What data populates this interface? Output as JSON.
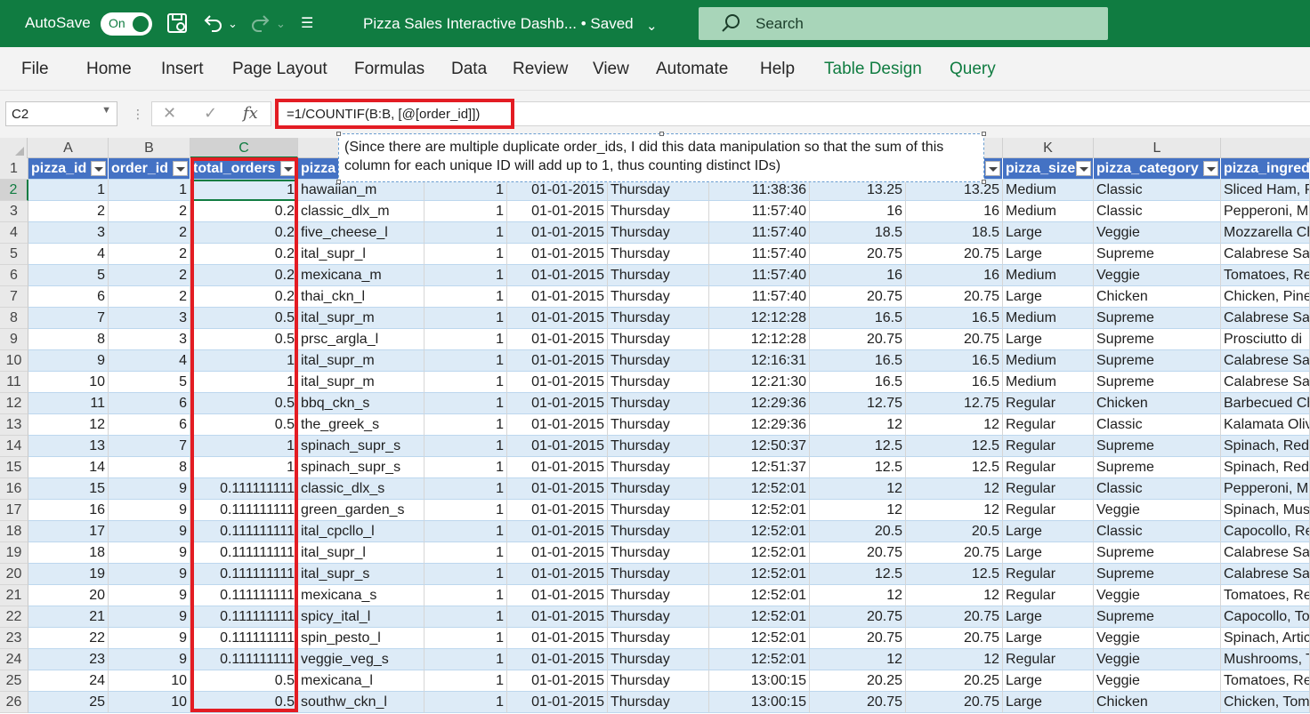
{
  "titlebar": {
    "autosave_label": "AutoSave",
    "autosave_state": "On",
    "doc_title": "Pizza Sales Interactive Dashb...  •  Saved",
    "search_placeholder": "Search"
  },
  "ribbon": {
    "tabs": [
      "File",
      "Home",
      "Insert",
      "Page Layout",
      "Formulas",
      "Data",
      "Review",
      "View",
      "Automate",
      "Help",
      "Table Design",
      "Query"
    ]
  },
  "formula_bar": {
    "name_box": "C2",
    "formula": "=1/COUNTIF(B:B, [@[order_id]])"
  },
  "comment": {
    "text": "(Since there are multiple duplicate order_ids, I did this data manipulation so that the sum of this column for each unique ID will add up to 1, thus counting distinct IDs)"
  },
  "grid": {
    "column_letters": [
      "A",
      "B",
      "C",
      "K",
      "L"
    ],
    "headers": [
      "pizza_id",
      "order_id",
      "total_orders",
      "pizza",
      "",
      "",
      "",
      "",
      "",
      "",
      "pizza_size",
      "pizza_category",
      "pizza_ingredi"
    ],
    "rows": [
      [
        "1",
        "1",
        "1",
        "hawaiian_m",
        "1",
        "01-01-2015",
        "Thursday",
        "11:38:36",
        "13.25",
        "13.25",
        "Medium",
        "Classic",
        "Sliced Ham, P"
      ],
      [
        "2",
        "2",
        "0.2",
        "classic_dlx_m",
        "1",
        "01-01-2015",
        "Thursday",
        "11:57:40",
        "16",
        "16",
        "Medium",
        "Classic",
        "Pepperoni, M"
      ],
      [
        "3",
        "2",
        "0.2",
        "five_cheese_l",
        "1",
        "01-01-2015",
        "Thursday",
        "11:57:40",
        "18.5",
        "18.5",
        "Large",
        "Veggie",
        "Mozzarella Ch"
      ],
      [
        "4",
        "2",
        "0.2",
        "ital_supr_l",
        "1",
        "01-01-2015",
        "Thursday",
        "11:57:40",
        "20.75",
        "20.75",
        "Large",
        "Supreme",
        "Calabrese Sal"
      ],
      [
        "5",
        "2",
        "0.2",
        "mexicana_m",
        "1",
        "01-01-2015",
        "Thursday",
        "11:57:40",
        "16",
        "16",
        "Medium",
        "Veggie",
        "Tomatoes, Re"
      ],
      [
        "6",
        "2",
        "0.2",
        "thai_ckn_l",
        "1",
        "01-01-2015",
        "Thursday",
        "11:57:40",
        "20.75",
        "20.75",
        "Large",
        "Chicken",
        "Chicken, Pine"
      ],
      [
        "7",
        "3",
        "0.5",
        "ital_supr_m",
        "1",
        "01-01-2015",
        "Thursday",
        "12:12:28",
        "16.5",
        "16.5",
        "Medium",
        "Supreme",
        "Calabrese Sal"
      ],
      [
        "8",
        "3",
        "0.5",
        "prsc_argla_l",
        "1",
        "01-01-2015",
        "Thursday",
        "12:12:28",
        "20.75",
        "20.75",
        "Large",
        "Supreme",
        "Prosciutto di"
      ],
      [
        "9",
        "4",
        "1",
        "ital_supr_m",
        "1",
        "01-01-2015",
        "Thursday",
        "12:16:31",
        "16.5",
        "16.5",
        "Medium",
        "Supreme",
        "Calabrese Sal"
      ],
      [
        "10",
        "5",
        "1",
        "ital_supr_m",
        "1",
        "01-01-2015",
        "Thursday",
        "12:21:30",
        "16.5",
        "16.5",
        "Medium",
        "Supreme",
        "Calabrese Sal"
      ],
      [
        "11",
        "6",
        "0.5",
        "bbq_ckn_s",
        "1",
        "01-01-2015",
        "Thursday",
        "12:29:36",
        "12.75",
        "12.75",
        "Regular",
        "Chicken",
        "Barbecued Ch"
      ],
      [
        "12",
        "6",
        "0.5",
        "the_greek_s",
        "1",
        "01-01-2015",
        "Thursday",
        "12:29:36",
        "12",
        "12",
        "Regular",
        "Classic",
        "Kalamata Oliv"
      ],
      [
        "13",
        "7",
        "1",
        "spinach_supr_s",
        "1",
        "01-01-2015",
        "Thursday",
        "12:50:37",
        "12.5",
        "12.5",
        "Regular",
        "Supreme",
        "Spinach, Red"
      ],
      [
        "14",
        "8",
        "1",
        "spinach_supr_s",
        "1",
        "01-01-2015",
        "Thursday",
        "12:51:37",
        "12.5",
        "12.5",
        "Regular",
        "Supreme",
        "Spinach, Red"
      ],
      [
        "15",
        "9",
        "0.111111111",
        "classic_dlx_s",
        "1",
        "01-01-2015",
        "Thursday",
        "12:52:01",
        "12",
        "12",
        "Regular",
        "Classic",
        "Pepperoni, M"
      ],
      [
        "16",
        "9",
        "0.111111111",
        "green_garden_s",
        "1",
        "01-01-2015",
        "Thursday",
        "12:52:01",
        "12",
        "12",
        "Regular",
        "Veggie",
        "Spinach, Mus"
      ],
      [
        "17",
        "9",
        "0.111111111",
        "ital_cpcllo_l",
        "1",
        "01-01-2015",
        "Thursday",
        "12:52:01",
        "20.5",
        "20.5",
        "Large",
        "Classic",
        "Capocollo, Re"
      ],
      [
        "18",
        "9",
        "0.111111111",
        "ital_supr_l",
        "1",
        "01-01-2015",
        "Thursday",
        "12:52:01",
        "20.75",
        "20.75",
        "Large",
        "Supreme",
        "Calabrese Sal"
      ],
      [
        "19",
        "9",
        "0.111111111",
        "ital_supr_s",
        "1",
        "01-01-2015",
        "Thursday",
        "12:52:01",
        "12.5",
        "12.5",
        "Regular",
        "Supreme",
        "Calabrese Sal"
      ],
      [
        "20",
        "9",
        "0.111111111",
        "mexicana_s",
        "1",
        "01-01-2015",
        "Thursday",
        "12:52:01",
        "12",
        "12",
        "Regular",
        "Veggie",
        "Tomatoes, Re"
      ],
      [
        "21",
        "9",
        "0.111111111",
        "spicy_ital_l",
        "1",
        "01-01-2015",
        "Thursday",
        "12:52:01",
        "20.75",
        "20.75",
        "Large",
        "Supreme",
        "Capocollo, To"
      ],
      [
        "22",
        "9",
        "0.111111111",
        "spin_pesto_l",
        "1",
        "01-01-2015",
        "Thursday",
        "12:52:01",
        "20.75",
        "20.75",
        "Large",
        "Veggie",
        "Spinach, Artic"
      ],
      [
        "23",
        "9",
        "0.111111111",
        "veggie_veg_s",
        "1",
        "01-01-2015",
        "Thursday",
        "12:52:01",
        "12",
        "12",
        "Regular",
        "Veggie",
        "Mushrooms, T"
      ],
      [
        "24",
        "10",
        "0.5",
        "mexicana_l",
        "1",
        "01-01-2015",
        "Thursday",
        "13:00:15",
        "20.25",
        "20.25",
        "Large",
        "Veggie",
        "Tomatoes, Re"
      ],
      [
        "25",
        "10",
        "0.5",
        "southw_ckn_l",
        "1",
        "01-01-2015",
        "Thursday",
        "13:00:15",
        "20.75",
        "20.75",
        "Large",
        "Chicken",
        "Chicken, Tom"
      ]
    ]
  },
  "colors": {
    "excel_green": "#107c41",
    "header_blue": "#4472c4",
    "band_blue": "#ddebf7",
    "highlight_red": "#e31c23"
  }
}
